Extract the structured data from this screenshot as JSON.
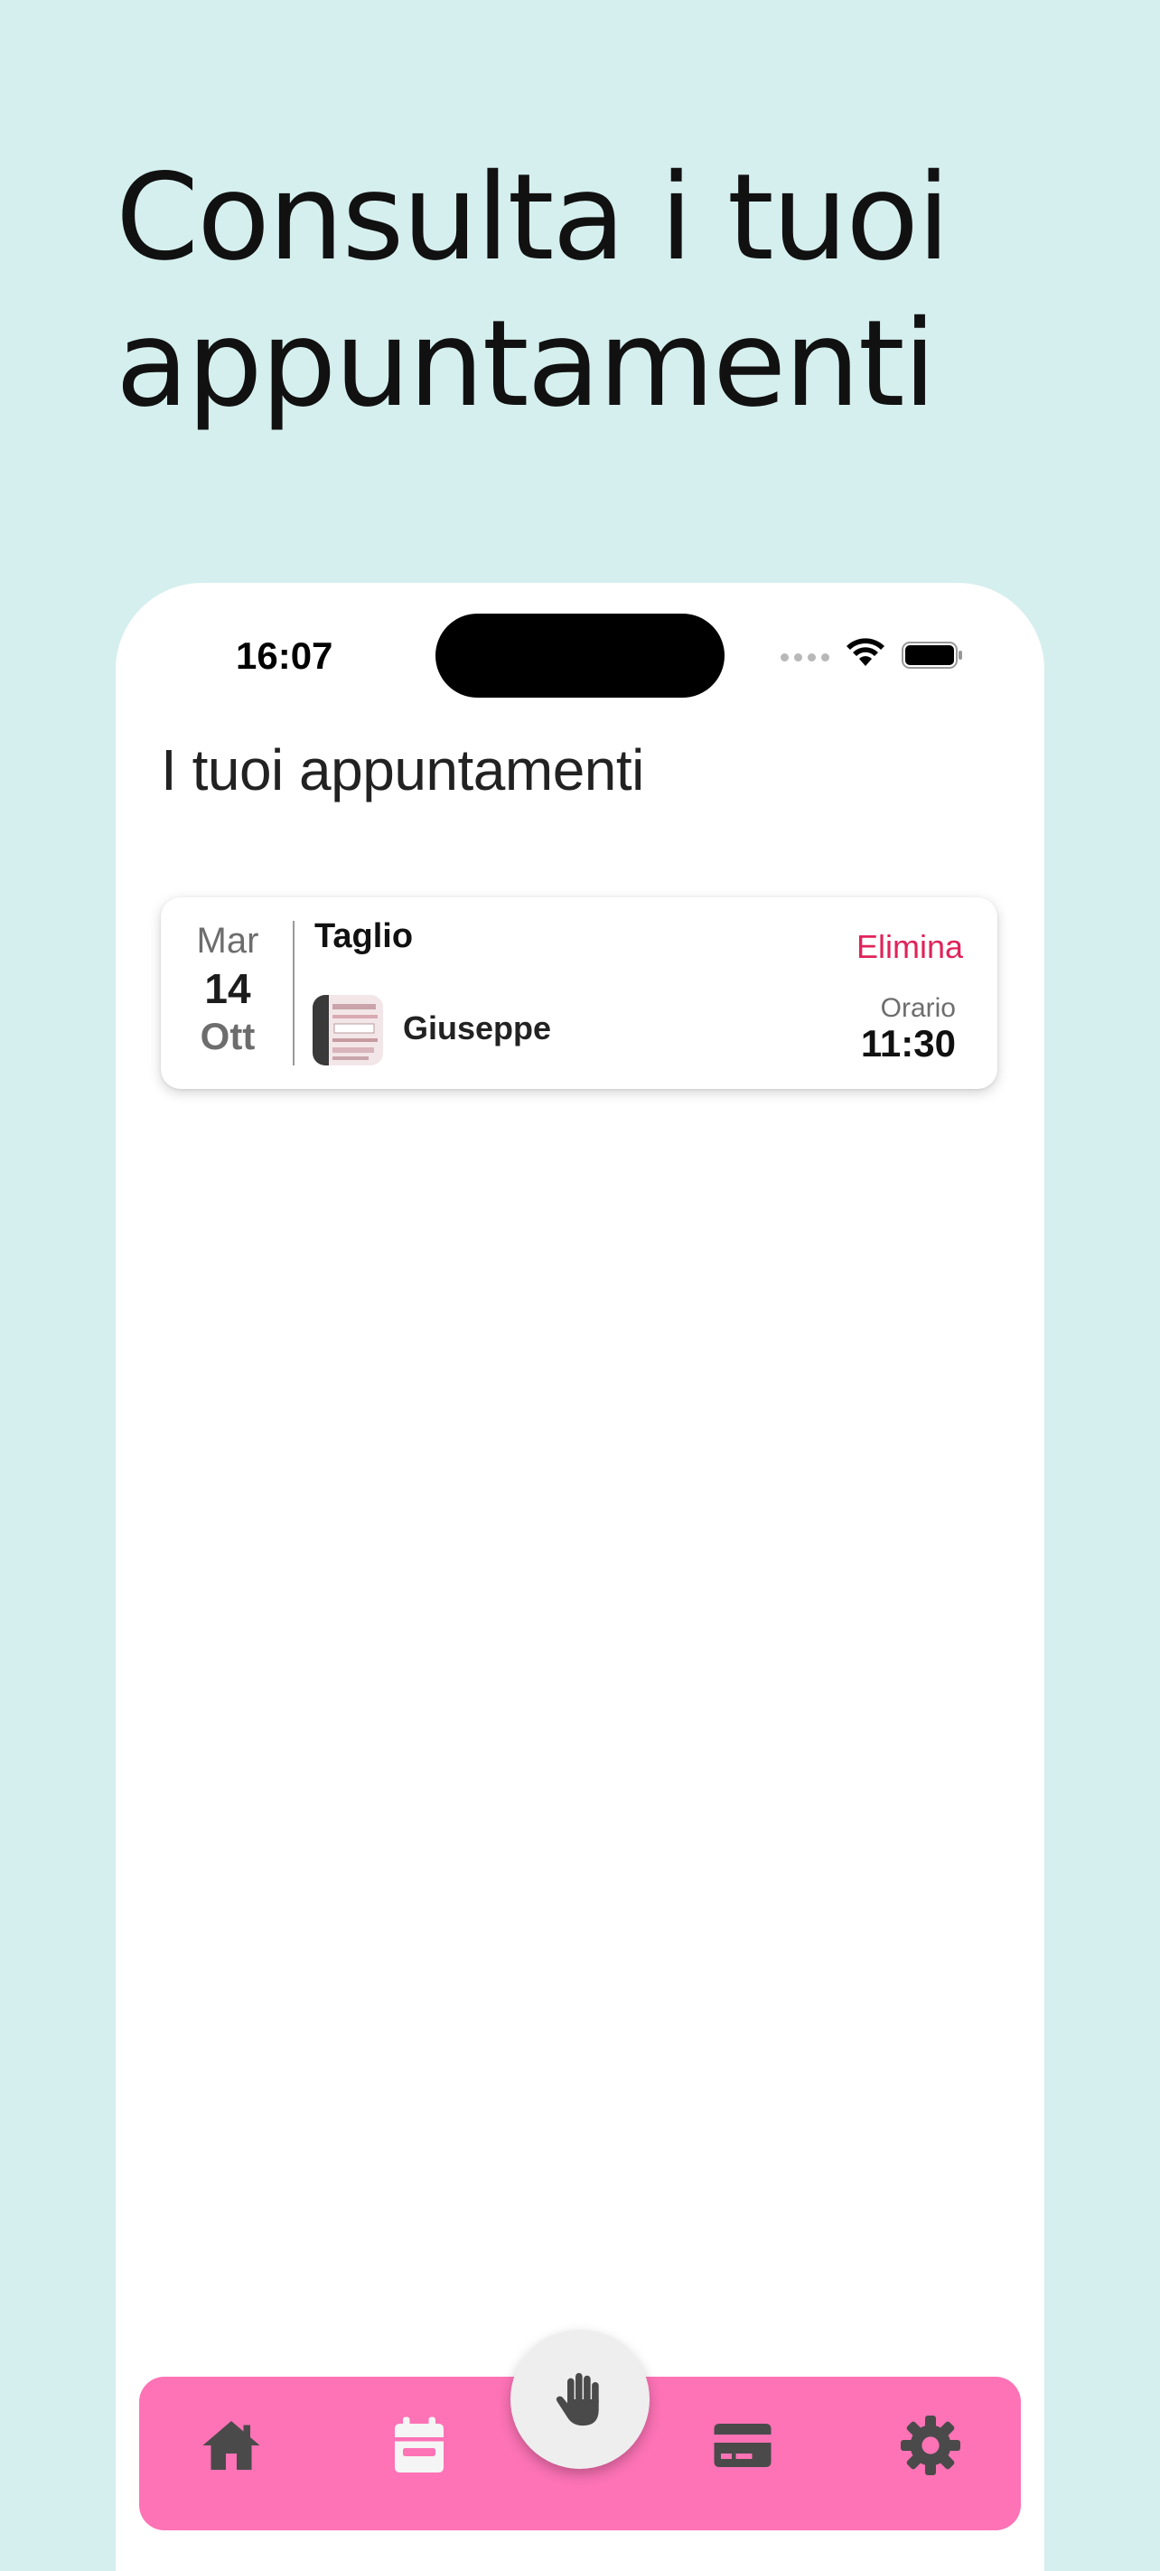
{
  "headline": {
    "line1": "Consulta i tuoi",
    "line2": "appuntamenti"
  },
  "status_bar": {
    "time": "16:07",
    "icons": [
      "signal-icon",
      "wifi-icon",
      "battery-icon"
    ]
  },
  "screen": {
    "title": "I tuoi appuntamenti"
  },
  "appointments": [
    {
      "weekday": "Mar",
      "day": "14",
      "month": "Ott",
      "service": "Taglio",
      "delete_label": "Elimina",
      "staff_name": "Giuseppe",
      "time_label": "Orario",
      "time": "11:30"
    }
  ],
  "tab_bar": {
    "items": [
      {
        "icon": "home-icon"
      },
      {
        "icon": "calendar-icon"
      },
      {
        "icon": "hand-icon"
      },
      {
        "icon": "credit-card-icon"
      },
      {
        "icon": "gear-icon"
      }
    ]
  },
  "colors": {
    "background": "#d5efee",
    "accent_pink": "#fd73b6",
    "delete_red": "#e0235a",
    "icon_dark": "#4a4a4a"
  }
}
